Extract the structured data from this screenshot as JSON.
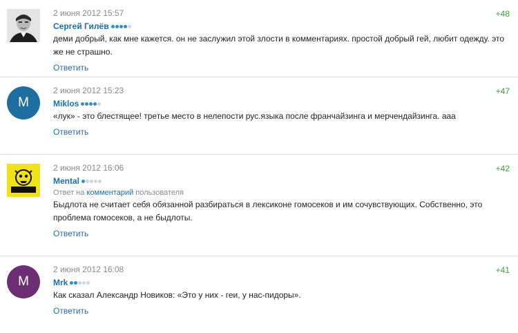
{
  "comments": [
    {
      "date": "2 июня 2012 15:57",
      "author": "Сергей Гилёв",
      "rating_level": 4,
      "rating_max": 5,
      "score": "+48",
      "text": "деми добрый, как мне кажется. он не заслужил этой злости в комментариях. простой добрый гей, любит одежду. это же не страшно.",
      "reply_label": "Ответить",
      "avatar": "photo-avatar"
    },
    {
      "date": "2 июня 2012 15:23",
      "author": "Miklos",
      "rating_level": 4,
      "rating_max": 5,
      "score": "+47",
      "text": "«лук» - это блестящее! третье место в нелепости рус.языка после франчайзинга и мерчендайзинга. ааа",
      "reply_label": "Ответить",
      "avatar_letter": "M",
      "avatar_color": "#1f6ea0"
    },
    {
      "date": "2 июня 2012 16:06",
      "author": "Mental",
      "rating_level": 1,
      "rating_max": 5,
      "score": "+42",
      "reply_note_prefix": "Ответ на",
      "reply_note_link": "комментарий",
      "reply_note_suffix": "пользователя",
      "text": "Быдлота не считает себя обязанной разбираться в лексиконе гомосеков и им сочувствующих. Собственно, это проблема гомосеков, а не быдлоты.",
      "reply_label": "Ответить",
      "avatar_label": "BRAINIAC",
      "avatar_color": "#f2e21c"
    },
    {
      "date": "2 июня 2012 16:08",
      "author": "Mrk",
      "rating_level": 2,
      "rating_max": 5,
      "score": "+41",
      "text": "Как сказал Александр Новиков: «Это у них - геи, у нас-пидоры».",
      "reply_label": "Ответить",
      "avatar_letter": "M",
      "avatar_color": "#6e2e73"
    }
  ]
}
